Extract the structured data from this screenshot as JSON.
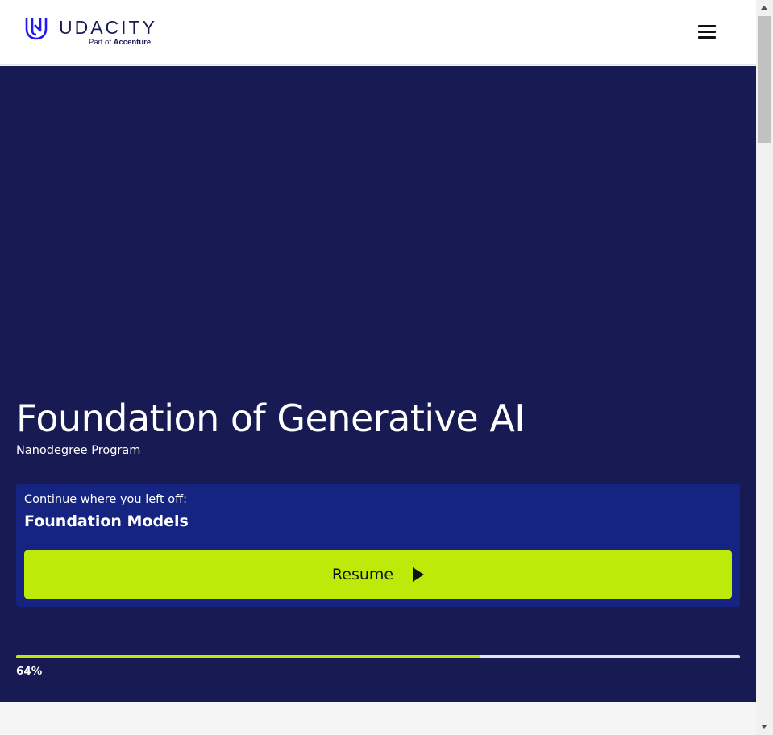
{
  "header": {
    "logo_text": "UDACITY",
    "logo_sub_prefix": "Part of",
    "logo_sub_brand": "Accenture",
    "menu_icon": "hamburger-menu-icon"
  },
  "program": {
    "title": "Foundation of Generative AI",
    "subtitle": "Nanodegree Program"
  },
  "resume": {
    "prompt": "Continue where you left off:",
    "lesson": "Foundation Models",
    "button_label": "Resume",
    "button_icon": "play-icon"
  },
  "progress": {
    "label": "64%",
    "value": 0.64
  },
  "colors": {
    "brand_navy": "#171a53",
    "card_blue": "#142480",
    "accent_lime": "#bdea09",
    "logo_blue": "#2015ff"
  }
}
